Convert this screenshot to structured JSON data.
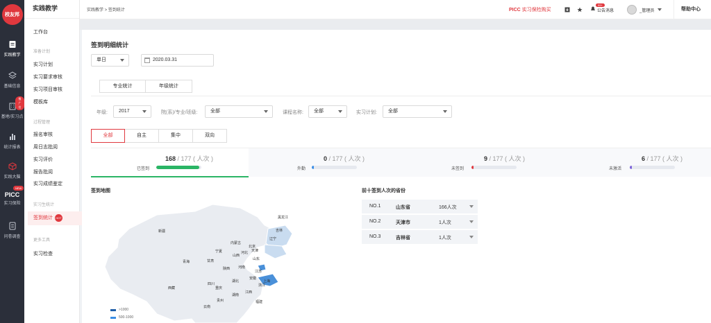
{
  "app": {
    "logo_text": "校友邦",
    "module_title": "实践教学",
    "breadcrumb": "实践教学 > 签到统计"
  },
  "rail": [
    {
      "label": "实践教学",
      "icon": "clipboard-icon",
      "badge": ""
    },
    {
      "label": "基础信息",
      "icon": "layers-icon",
      "badge": ""
    },
    {
      "label": "基地/实习点",
      "icon": "building-icon",
      "badge": "推广位"
    },
    {
      "label": "统计报表",
      "icon": "bar-chart-icon",
      "badge": ""
    },
    {
      "label": "实践大脑",
      "icon": "cube-icon",
      "badge": ""
    },
    {
      "label": "实习保险",
      "icon": "picc-icon",
      "badge": "NEW",
      "brand": "PICC"
    },
    {
      "label": "问卷调查",
      "icon": "survey-icon",
      "badge": ""
    }
  ],
  "sidebar": {
    "workbench": "工作台",
    "group_prep": "准备计划",
    "prep_items": [
      "实习计划",
      "实习要求审核",
      "实习项目审核",
      "模板库"
    ],
    "group_process": "过程管理",
    "process_items": [
      "报名审核",
      "周日志批阅",
      "实习评价",
      "报告批阅",
      "实习成绩鉴定"
    ],
    "group_stats": "实习生统计",
    "active_item": "签到统计",
    "hot_label": "HOT",
    "group_tools": "更多工具",
    "tools_items": [
      "实习检查"
    ]
  },
  "topbar": {
    "picc_brand": "PICC",
    "picc_text": "实习保险购买",
    "notice_label": "公告消息",
    "notice_badge": "99+",
    "user_name": "_管理员",
    "help_label": "帮助中心"
  },
  "page": {
    "title": "签到明细统计",
    "range_select": "单日",
    "date_value": "2020.03.31",
    "tabs": [
      "专业统计",
      "年级统计"
    ],
    "filters": [
      {
        "label": "年级:",
        "value": "2017"
      },
      {
        "label": "院(系)/专业/班级:",
        "value": "全部"
      },
      {
        "label": "课程名称:",
        "value": "全部"
      },
      {
        "label": "实习计划:",
        "value": "全部"
      }
    ],
    "segments": [
      "全部",
      "自主",
      "集中",
      "双向"
    ],
    "active_segment": "全部"
  },
  "stats": [
    {
      "value": "168",
      "total": " / 177 ( 人次 )",
      "label": "已签到",
      "progress": 0.95,
      "color": "#2ab565"
    },
    {
      "value": "0",
      "total": " / 177 ( 人次 )",
      "label": "外勤",
      "progress": 0.04,
      "color": "#3a8ee6"
    },
    {
      "value": "9",
      "total": " / 177 ( 人次 )",
      "label": "未签到",
      "progress": 0.05,
      "color": "#e0383e"
    },
    {
      "value": "6",
      "total": " / 177 ( 人次 )",
      "label": "未激活",
      "progress": 0.04,
      "color": "#7b61d9"
    }
  ],
  "map": {
    "title": "签到地图",
    "provinces": [
      "黑龙江",
      "吉林",
      "新疆",
      "内蒙古",
      "辽宁",
      "北京",
      "天津",
      "山西",
      "河北",
      "宁夏",
      "甘肃",
      "山东",
      "青海",
      "陕西",
      "河南",
      "江苏",
      "西藏",
      "四川",
      "湖北",
      "安徽",
      "上海",
      "重庆",
      "浙江",
      "江西",
      "湖南",
      "贵州",
      "福建",
      "云南"
    ],
    "legend": [
      {
        "label": ">1000",
        "color": "#1f5ea8"
      },
      {
        "label": "500-1000",
        "color": "#3a8ee6"
      }
    ]
  },
  "ranking": {
    "title": "前十签到人次的省份",
    "rows": [
      {
        "no": "NO.1",
        "province": "山东省",
        "count": "166人次"
      },
      {
        "no": "NO.2",
        "province": "天津市",
        "count": "1人次"
      },
      {
        "no": "NO.3",
        "province": "吉林省",
        "count": "1人次"
      }
    ]
  }
}
